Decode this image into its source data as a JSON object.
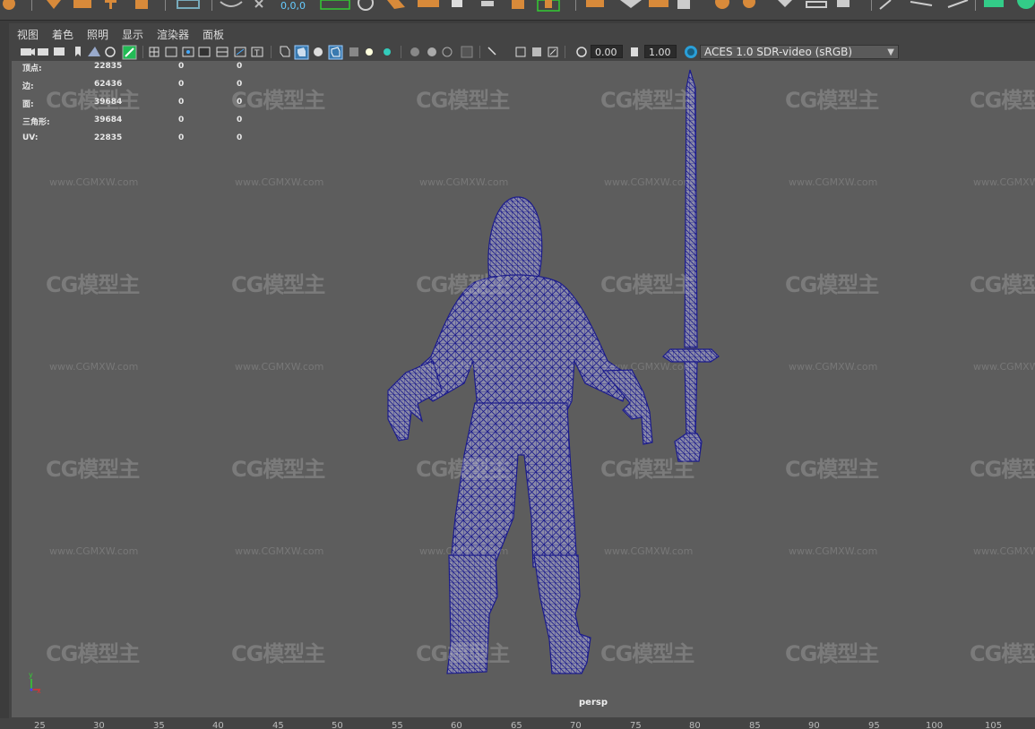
{
  "shelf": {
    "coords_label": "0,0,0"
  },
  "menu": [
    "视图",
    "着色",
    "照明",
    "显示",
    "渲染器",
    "面板"
  ],
  "toolbar": {
    "exposure": "0.00",
    "gamma": "1.00",
    "color_space": "ACES 1.0 SDR-video (sRGB)"
  },
  "hud": {
    "rows": [
      {
        "label": "顶点:",
        "v1": "22835",
        "v2": "0",
        "v3": "0"
      },
      {
        "label": "边:",
        "v1": "62436",
        "v2": "0",
        "v3": "0"
      },
      {
        "label": "面:",
        "v1": "39684",
        "v2": "0",
        "v3": "0"
      },
      {
        "label": "三角形:",
        "v1": "39684",
        "v2": "0",
        "v3": "0"
      },
      {
        "label": "UV:",
        "v1": "22835",
        "v2": "0",
        "v3": "0"
      }
    ]
  },
  "viewport": {
    "camera": "persp",
    "axis_y": "y",
    "axis_x": "x"
  },
  "watermark": {
    "logo": "CG模型主",
    "url": "www.CGMXW.com"
  },
  "ruler": [
    "25",
    "30",
    "35",
    "40",
    "45",
    "50",
    "55",
    "60",
    "65",
    "70",
    "75",
    "80",
    "85",
    "90",
    "95",
    "100",
    "105"
  ],
  "colors": {
    "wireframe": "#1c1c8c",
    "viewport_bg": "#5d5d5d",
    "panel_bg": "#444444"
  }
}
